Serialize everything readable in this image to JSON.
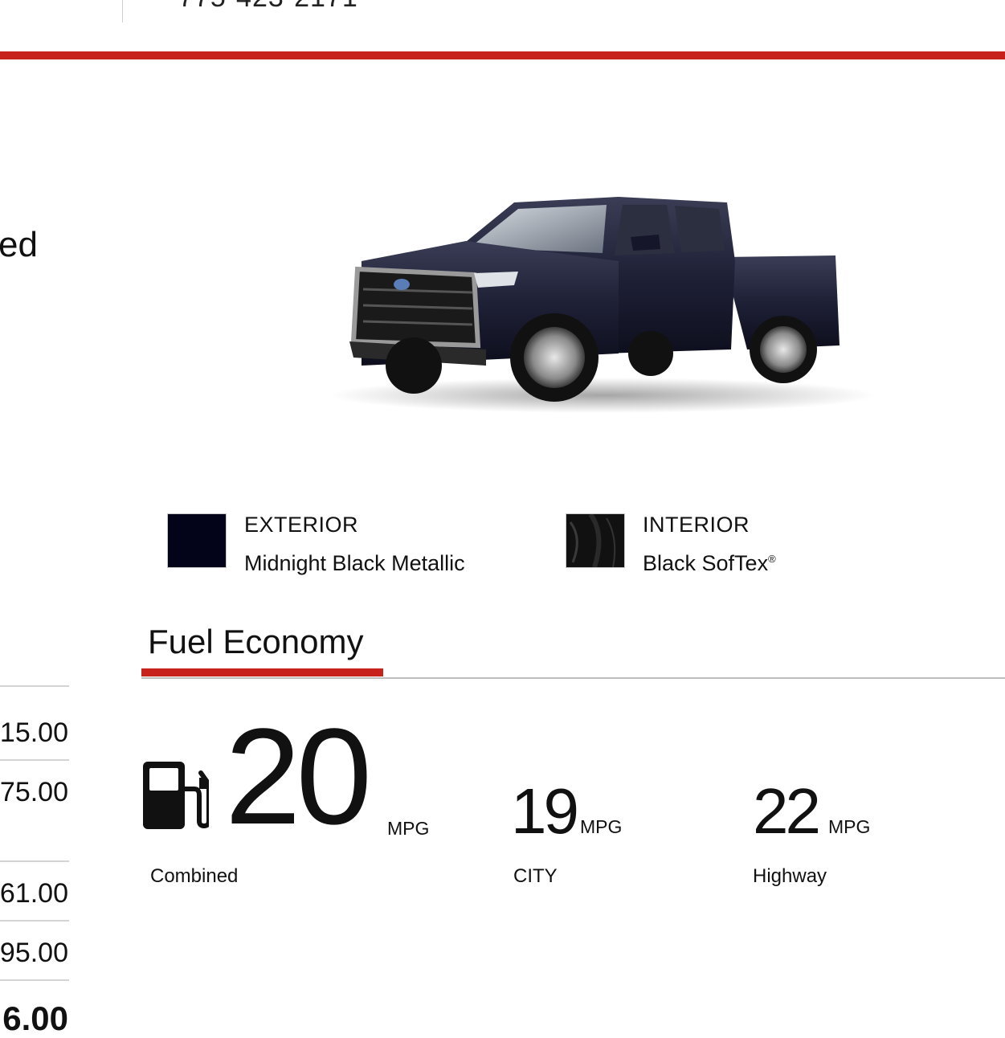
{
  "header": {
    "phone": "775-423-2171"
  },
  "left_heading": "ed",
  "vehicle": {
    "exterior": {
      "label": "EXTERIOR",
      "value": "Midnight Black Metallic",
      "swatch_color": "#03041a"
    },
    "interior": {
      "label": "INTERIOR",
      "value": "Black SofTex",
      "trademark": "®",
      "swatch_color": "#111111"
    }
  },
  "fuel_economy": {
    "title": "Fuel Economy",
    "combined": {
      "value": "20",
      "unit": "MPG",
      "label": "Combined"
    },
    "city": {
      "value": "19",
      "unit": "MPG",
      "label": "CITY"
    },
    "highway": {
      "value": "22",
      "unit": "MPG",
      "label": "Highway"
    }
  },
  "prices": [
    "15.00",
    "75.00",
    "61.00",
    "95.00"
  ],
  "price_total": "6.00",
  "colors": {
    "accent": "#c8221d"
  }
}
